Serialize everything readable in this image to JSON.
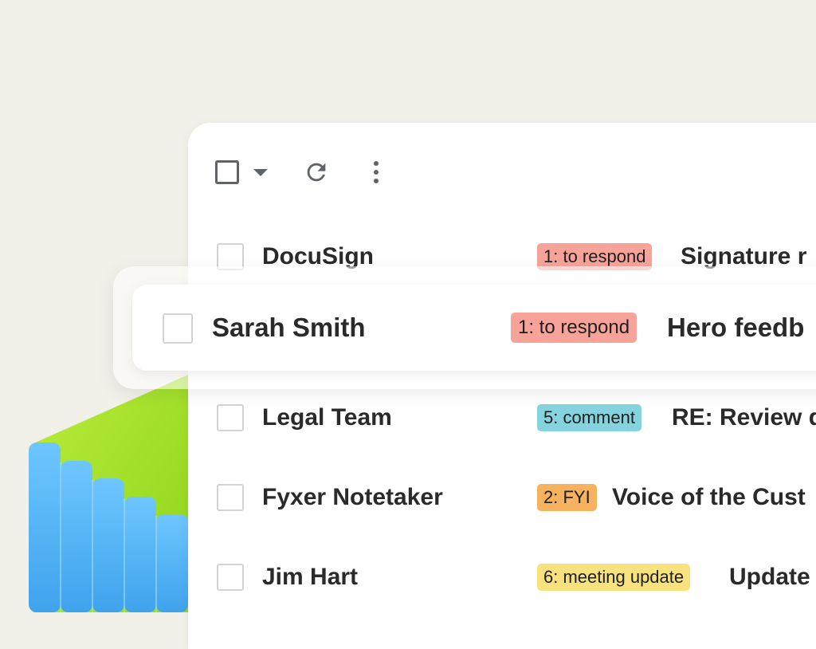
{
  "colors": {
    "background": "#f1f0e9",
    "panel": "#ffffff",
    "tag_to_respond": "#f7a399",
    "tag_comment": "#85d3de",
    "tag_fyi": "#f6b25f",
    "tag_meeting_update": "#f7e27e",
    "deco_green": "#a5e22a",
    "deco_blue": "#5ab7f2"
  },
  "toolbar": {
    "select_all_icon": "checkbox-icon",
    "select_menu_icon": "caret-down-icon",
    "refresh_icon": "refresh-icon",
    "more_icon": "more-vert-icon"
  },
  "emails": [
    {
      "sender": "DocuSign",
      "tag": "1: to respond",
      "subject": "Signature r"
    },
    {
      "sender": "Sarah Smith",
      "tag": "1: to respond",
      "subject": "Hero feedb",
      "highlighted": true
    },
    {
      "sender": "Legal Team",
      "tag": "5: comment",
      "subject": "RE: Review d"
    },
    {
      "sender": "Fyxer Notetaker",
      "tag": "2: FYI",
      "subject": "Voice of the Cust"
    },
    {
      "sender": "Jim Hart",
      "tag": "6: meeting update",
      "subject": "Update"
    }
  ]
}
